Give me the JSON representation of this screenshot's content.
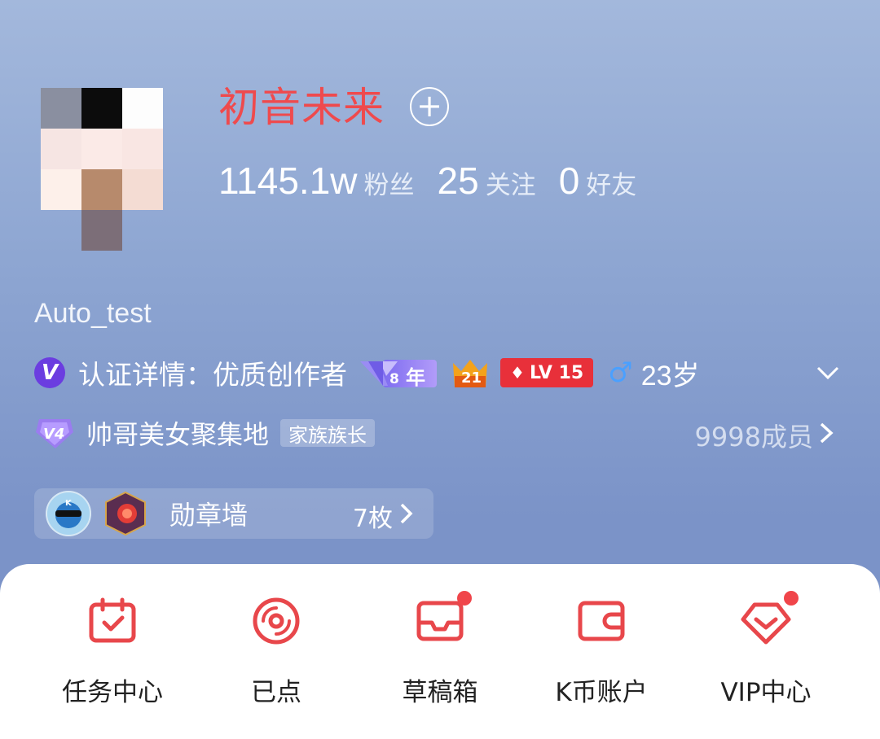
{
  "profile": {
    "username": "初音未来",
    "add_label": "+",
    "user_id": "Auto_test",
    "stats": [
      {
        "value": "1145.1w",
        "label": "粉丝"
      },
      {
        "value": "25",
        "label": "关注"
      },
      {
        "value": "0",
        "label": "好友"
      }
    ]
  },
  "certification": {
    "v_label": "V",
    "text": "认证详情：优质创作者",
    "year_badge": {
      "num": "8",
      "label": "年"
    },
    "crown_badge": "21",
    "level_badge": "LV 15",
    "gender_symbol": "♂",
    "age": "23岁"
  },
  "family": {
    "name": "帅哥美女聚集地",
    "role_tag": "家族族长",
    "member_count": "9998成员"
  },
  "medals": {
    "label": "勋章墙",
    "count": "7枚"
  },
  "tools": [
    {
      "label": "任务中心",
      "icon": "calendar-check-icon",
      "dot": false
    },
    {
      "label": "已点",
      "icon": "disc-icon",
      "dot": false
    },
    {
      "label": "草稿箱",
      "icon": "inbox-icon",
      "dot": true
    },
    {
      "label": "K币账户",
      "icon": "wallet-icon",
      "dot": false
    },
    {
      "label": "VIP中心",
      "icon": "vip-heart-icon",
      "dot": true
    }
  ],
  "colors": {
    "accent": "#e8474b",
    "username": "#ef4a4d",
    "background_top": "#a3b8dc",
    "background_bottom": "#7a92c6"
  }
}
